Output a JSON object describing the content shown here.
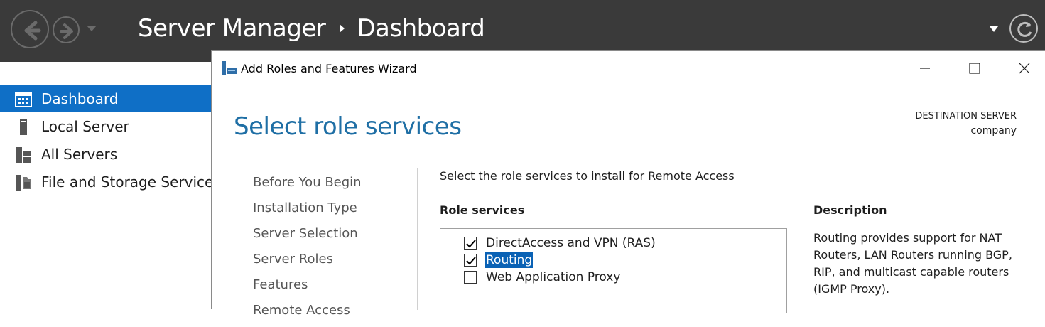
{
  "topbar": {
    "app_title": "Server Manager",
    "page_title": "Dashboard"
  },
  "sidebar": {
    "items": [
      {
        "label": "Dashboard",
        "icon": "dashboard-icon",
        "active": true
      },
      {
        "label": "Local Server",
        "icon": "server-icon",
        "active": false
      },
      {
        "label": "All Servers",
        "icon": "servers-icon",
        "active": false
      },
      {
        "label": "File and Storage Services",
        "icon": "storage-icon",
        "active": false
      }
    ]
  },
  "wizard": {
    "title": "Add Roles and Features Wizard",
    "heading": "Select role services",
    "destination_label": "DESTINATION SERVER",
    "destination_value": "company",
    "steps": [
      "Before You Begin",
      "Installation Type",
      "Server Selection",
      "Server Roles",
      "Features",
      "Remote Access"
    ],
    "instruction": "Select the role services to install for Remote Access",
    "role_services_header": "Role services",
    "role_services": [
      {
        "label": "DirectAccess and VPN (RAS)",
        "checked": true,
        "selected": false
      },
      {
        "label": "Routing",
        "checked": true,
        "selected": true
      },
      {
        "label": "Web Application Proxy",
        "checked": false,
        "selected": false
      }
    ],
    "description_header": "Description",
    "description": "Routing provides support for NAT Routers, LAN Routers running BGP, RIP, and multicast capable routers (IGMP Proxy)."
  },
  "colors": {
    "topbar_bg": "#3a3a3a",
    "accent": "#0f6fc6",
    "heading": "#1f6fa5",
    "selection": "#0a62b5"
  }
}
